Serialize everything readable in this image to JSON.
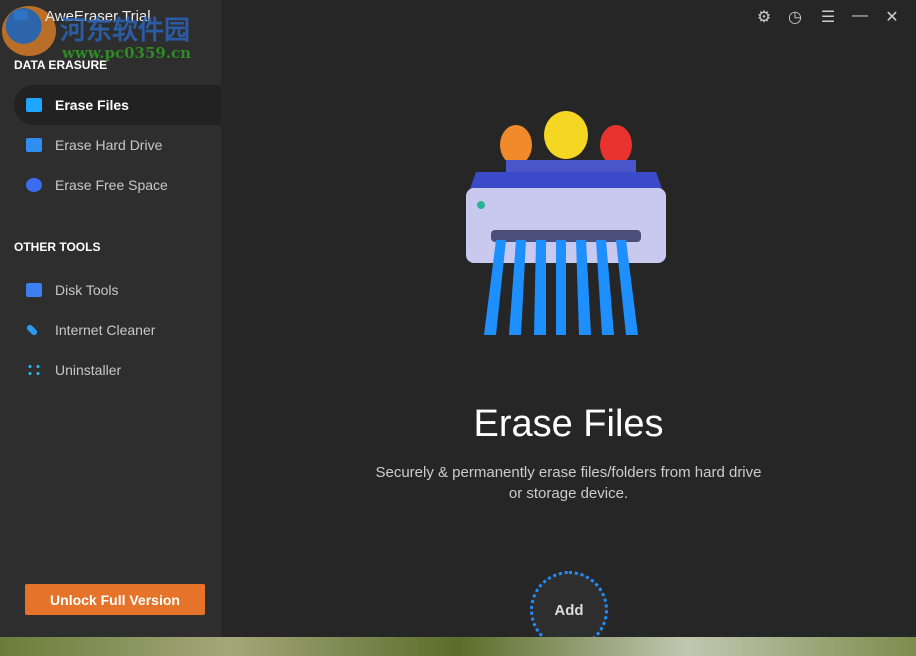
{
  "window": {
    "title": "AweEraser Trial"
  },
  "watermark": {
    "text": "河东软件园",
    "url": "www.pc0359.cn"
  },
  "sidebar": {
    "sections": [
      {
        "label": "DATA ERASURE"
      },
      {
        "label": "OTHER TOOLS"
      }
    ],
    "items": [
      {
        "label": "Erase Files",
        "icon": "folder-icon",
        "color": "#1ea7ff"
      },
      {
        "label": "Erase Hard Drive",
        "icon": "hard-drive-icon",
        "color": "#2f8ef0"
      },
      {
        "label": "Erase Free Space",
        "icon": "pie-chart-icon",
        "color": "#3b6df0"
      },
      {
        "label": "Disk Tools",
        "icon": "toolbox-icon",
        "color": "#3d7ef0"
      },
      {
        "label": "Internet Cleaner",
        "icon": "rocket-icon",
        "color": "#2a9af0"
      },
      {
        "label": "Uninstaller",
        "icon": "apps-icon",
        "color": "#2ab0e8"
      }
    ],
    "unlock_label": "Unlock Full Version"
  },
  "main": {
    "title": "Erase Files",
    "description_line1": "Securely & permanently erase files/folders from hard drive",
    "description_line2": "or storage device.",
    "add_label": "Add"
  },
  "toolbar": {
    "settings": "⚙",
    "history": "◷",
    "menu": "☰",
    "minimize": "—",
    "close": "✕"
  }
}
